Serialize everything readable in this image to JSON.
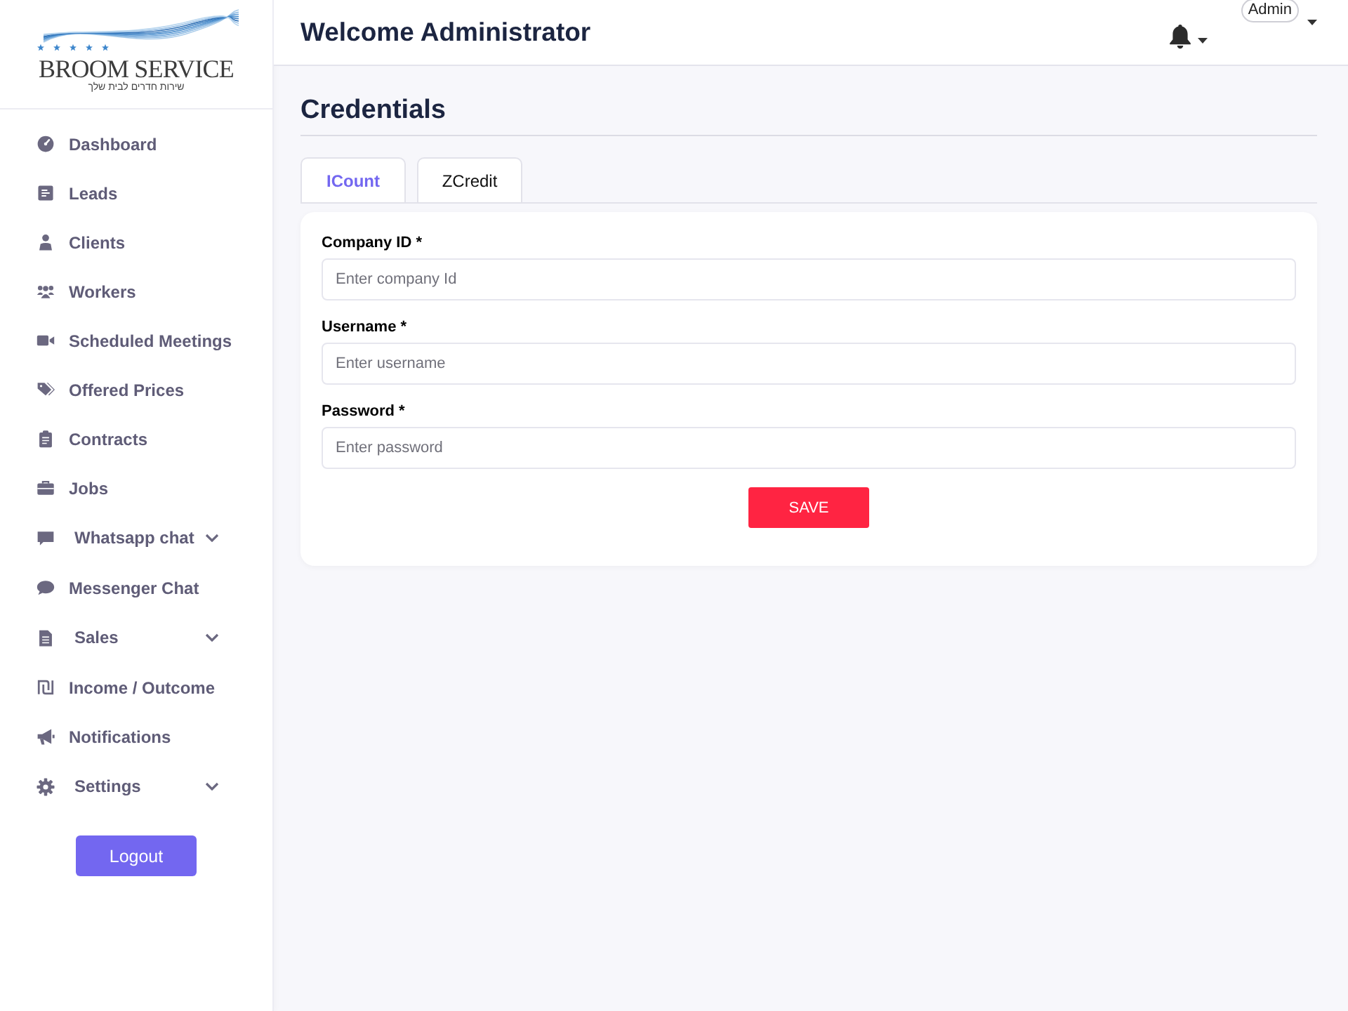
{
  "sidebar": {
    "brand": "BROOM SERVICE",
    "tagline": "שירות חדרים לבית שלך",
    "items": [
      {
        "label": "Dashboard",
        "kind": "link"
      },
      {
        "label": "Leads",
        "kind": "link"
      },
      {
        "label": "Clients",
        "kind": "link"
      },
      {
        "label": "Workers",
        "kind": "link"
      },
      {
        "label": "Scheduled Meetings",
        "kind": "link"
      },
      {
        "label": "Offered Prices",
        "kind": "link"
      },
      {
        "label": "Contracts",
        "kind": "link"
      },
      {
        "label": "Jobs",
        "kind": "link"
      },
      {
        "label": "Whatsapp chat",
        "kind": "group",
        "expanded": false
      },
      {
        "label": "Messenger Chat",
        "kind": "link"
      },
      {
        "label": "Sales",
        "kind": "group",
        "expanded": false
      },
      {
        "label": "Income / Outcome",
        "kind": "link"
      },
      {
        "label": "Notifications",
        "kind": "link"
      },
      {
        "label": "Settings",
        "kind": "group",
        "expanded": false
      }
    ],
    "logout": "Logout"
  },
  "header": {
    "title": "Welcome Administrator",
    "user": "Admin"
  },
  "credentials": {
    "title": "Credentials",
    "tabs": [
      {
        "label": "ICount",
        "selected": true
      },
      {
        "label": "ZCredit",
        "selected": false
      }
    ],
    "fields": [
      {
        "label": "Company ID *",
        "placeholder": "Enter company Id"
      },
      {
        "label": "Username *",
        "placeholder": "Enter username"
      },
      {
        "label": "Password *",
        "placeholder": "Enter password"
      }
    ],
    "save": "SAVE"
  }
}
